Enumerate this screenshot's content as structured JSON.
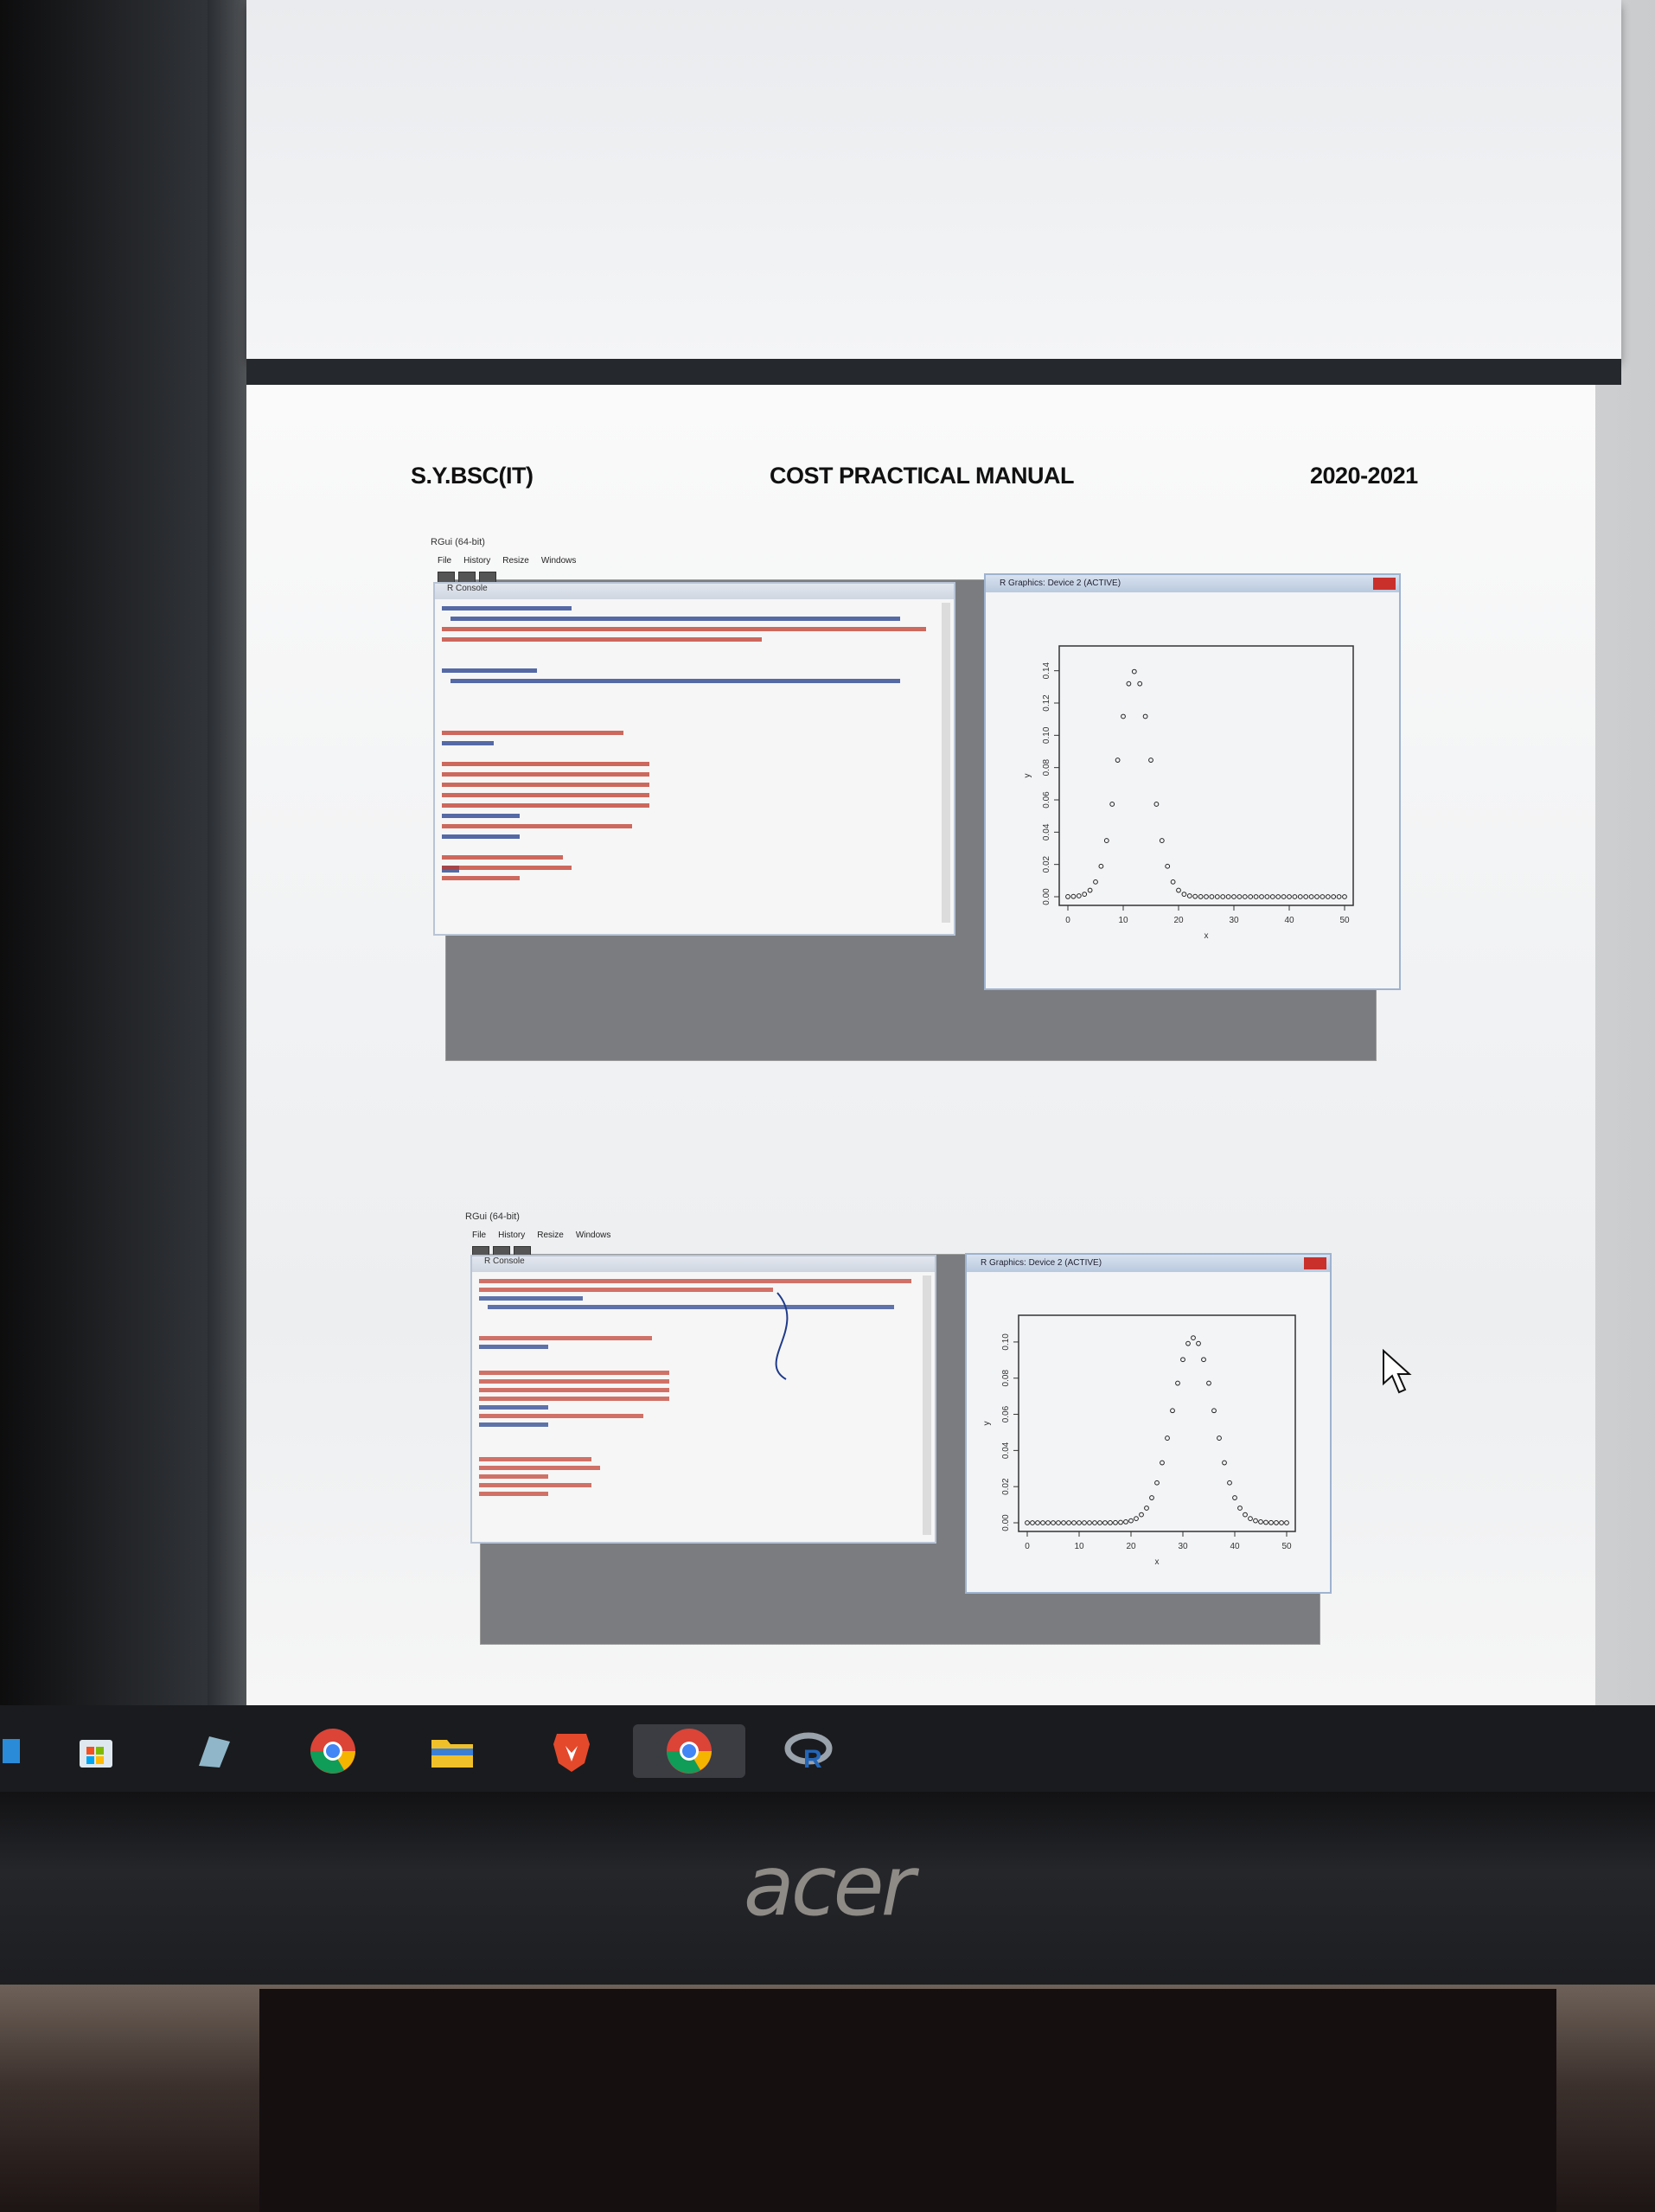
{
  "document": {
    "header_left": "S.Y.BSC(IT)",
    "header_center": "COST PRACTICAL MANUAL",
    "header_right": "2020-2021"
  },
  "screenshot1": {
    "window_title": "RGui (64-bit)",
    "menu": [
      "File",
      "History",
      "Resize",
      "Windows"
    ],
    "console_title": "R Console",
    "graphics_title": "R Graphics: Device 2 (ACTIVE)",
    "y_ticks": [
      "0.00",
      "0.02",
      "0.04",
      "0.06",
      "0.08",
      "0.10",
      "0.12",
      "0.14"
    ],
    "x_ticks": [
      "0",
      "10",
      "20",
      "30",
      "40",
      "50"
    ],
    "xlabel": "x",
    "ylabel": "y"
  },
  "screenshot2": {
    "window_title": "RGui (64-bit)",
    "menu": [
      "File",
      "History",
      "Resize",
      "Windows"
    ],
    "console_title": "R Console",
    "graphics_title": "R Graphics: Device 2 (ACTIVE)",
    "y_ticks": [
      "0.00",
      "0.02",
      "0.04",
      "0.06",
      "0.08",
      "0.10"
    ],
    "x_ticks": [
      "0",
      "10",
      "20",
      "30",
      "40",
      "50"
    ],
    "xlabel": "x",
    "ylabel": "y"
  },
  "taskbar": {
    "items": [
      "file-explorer-icon",
      "microsoft-store-icon",
      "notepad-icon",
      "chrome-icon",
      "folder-icon",
      "brave-icon",
      "chrome-icon",
      "r-icon"
    ],
    "active_index": 6
  },
  "brand": "acer",
  "colors": {
    "page": "#f6f6f6",
    "taskbar": "#1a1b1e",
    "console_red": "#c0392b",
    "console_blue": "#1f3b8a",
    "close_red": "#c9302c"
  }
}
